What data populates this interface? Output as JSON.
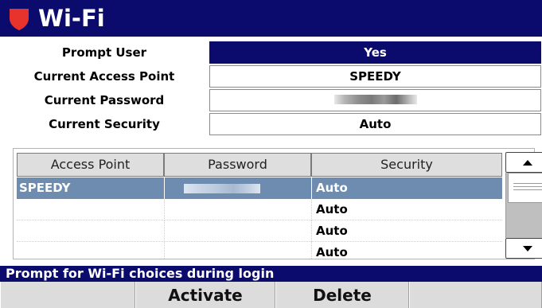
{
  "window": {
    "title": "Wi-Fi",
    "shield_color": "#e8322c",
    "title_bar_color": "#0b0b6e"
  },
  "settings": [
    {
      "label": "Prompt User",
      "value": "Yes",
      "selected": true
    },
    {
      "label": "Current Access Point",
      "value": "SPEEDY",
      "selected": false
    },
    {
      "label": "Current Password",
      "value": "",
      "obscured": true,
      "selected": false
    },
    {
      "label": "Current Security",
      "value": "Auto",
      "selected": false
    }
  ],
  "table": {
    "columns": [
      "Access Point",
      "Password",
      "Security"
    ],
    "rows": [
      {
        "access_point": "SPEEDY",
        "password_obscured": true,
        "security": "Auto",
        "selected": true
      },
      {
        "access_point": "",
        "password_obscured": false,
        "security": "Auto",
        "selected": false
      },
      {
        "access_point": "",
        "password_obscured": false,
        "security": "Auto",
        "selected": false
      },
      {
        "access_point": "",
        "password_obscured": false,
        "security": "Auto",
        "selected": false
      }
    ],
    "selected_row_color": "#6e8cb0"
  },
  "scrollbar": {
    "up_icon": "arrow-up-icon",
    "down_icon": "arrow-down-icon"
  },
  "status_bar": {
    "text": "Prompt for Wi-Fi choices during login"
  },
  "softkeys": [
    {
      "label": ""
    },
    {
      "label": "Activate"
    },
    {
      "label": "Delete"
    },
    {
      "label": ""
    }
  ]
}
